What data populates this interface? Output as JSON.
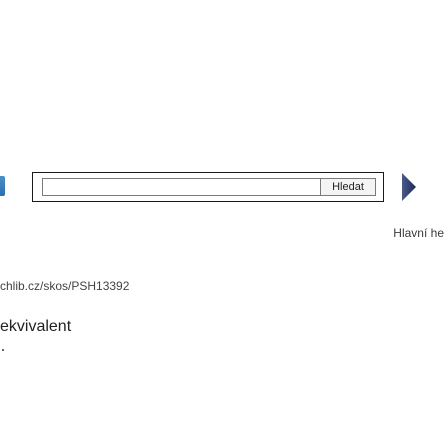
{
  "search": {
    "button_label": "Hledat",
    "placeholder": "",
    "value": ""
  },
  "nav": {
    "main_label": "Hlavní he"
  },
  "concept": {
    "uri": "chlib.cz/skos/PSH13392",
    "field_label": "ekvivalent"
  },
  "icons": {
    "logo": "logo-fragment",
    "next": "arrow-right-icon"
  },
  "colors": {
    "logo_blue": "#2d6fb0",
    "arrow_blue": "#2a3a6e",
    "border": "#1a1a1a"
  }
}
